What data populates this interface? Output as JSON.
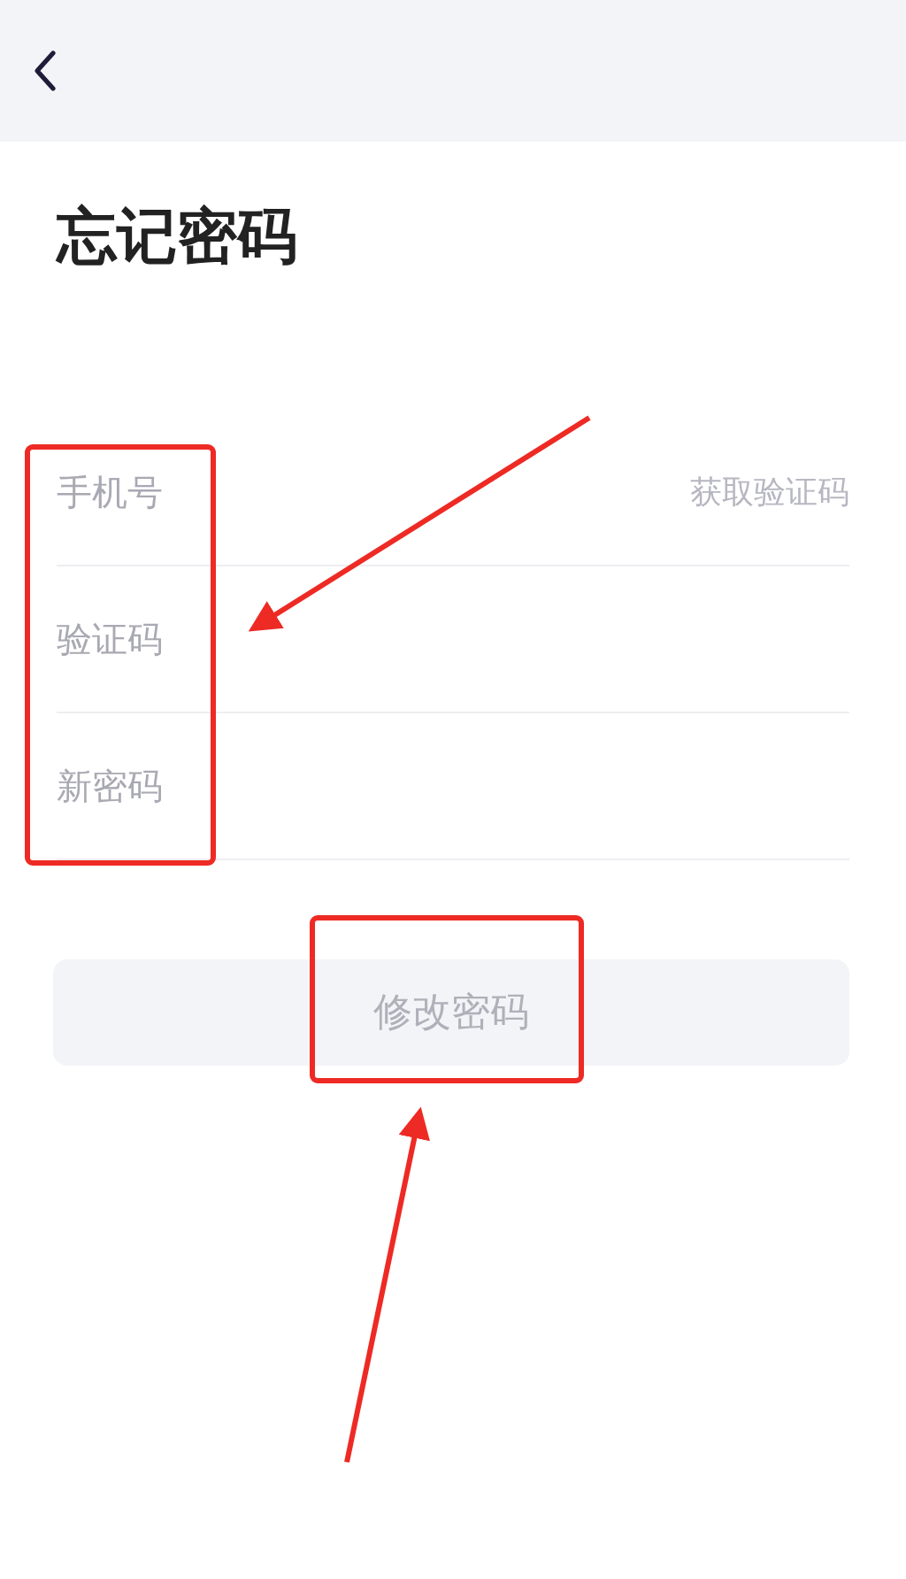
{
  "title": "忘记密码",
  "fields": [
    {
      "placeholder": "手机号",
      "action": "获取验证码"
    },
    {
      "placeholder": "验证码"
    },
    {
      "placeholder": "新密码"
    }
  ],
  "submit_button": {
    "label": "修改密码",
    "disabled": true
  }
}
